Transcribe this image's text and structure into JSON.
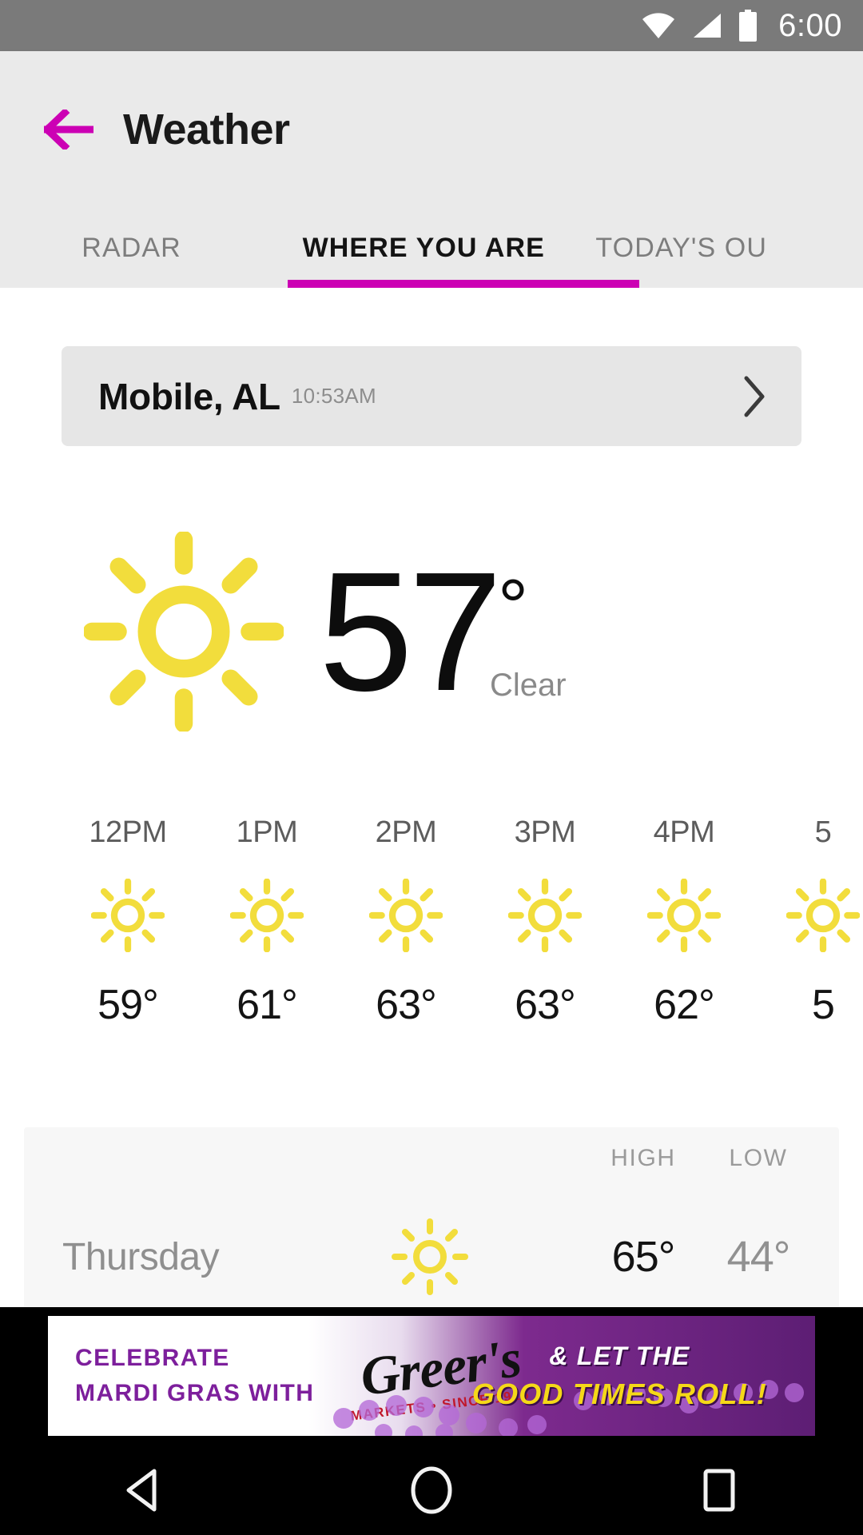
{
  "status_bar": {
    "time": "6:00",
    "icons": [
      "wifi-icon",
      "cellular-signal-icon",
      "battery-icon"
    ]
  },
  "app_bar": {
    "back_icon": "arrow-left-icon",
    "title": "Weather",
    "accent_color": "#cc00b4"
  },
  "tabs": {
    "items": [
      {
        "label": "RADAR",
        "active": false
      },
      {
        "label": "WHERE YOU ARE",
        "active": true
      },
      {
        "label": "TODAY'S OU",
        "active": false
      }
    ]
  },
  "location": {
    "name": "Mobile, AL",
    "time": "10:53AM",
    "chevron_icon": "chevron-right-icon"
  },
  "current": {
    "icon": "sun-icon",
    "temperature": "57",
    "degree": "°",
    "condition": "Clear",
    "icon_color": "#f2dd3c"
  },
  "hourly": {
    "items": [
      {
        "time": "12PM",
        "icon": "sun-icon",
        "temp": "59°"
      },
      {
        "time": "1PM",
        "icon": "sun-icon",
        "temp": "61°"
      },
      {
        "time": "2PM",
        "icon": "sun-icon",
        "temp": "63°"
      },
      {
        "time": "3PM",
        "icon": "sun-icon",
        "temp": "63°"
      },
      {
        "time": "4PM",
        "icon": "sun-icon",
        "temp": "62°"
      },
      {
        "time": "5",
        "icon": "sun-icon",
        "temp": "5"
      }
    ]
  },
  "daily": {
    "high_label": "HIGH",
    "low_label": "LOW",
    "rows": [
      {
        "day": "Thursday",
        "icon": "sun-icon",
        "high": "65°",
        "low": "44°"
      }
    ]
  },
  "ad": {
    "line1": "CELEBRATE",
    "line2": "MARDI GRAS WITH",
    "brand": "Greer's",
    "brand_sub": "MARKETS • SINCE 1916",
    "right1": "& LET THE",
    "right2": "GOOD TIMES ROLL!",
    "purple": "#7d1f9c",
    "yellow": "#f5d818"
  },
  "nav_bar": {
    "back_icon": "triangle-back-icon",
    "home_icon": "circle-home-icon",
    "recents_icon": "square-recents-icon"
  }
}
